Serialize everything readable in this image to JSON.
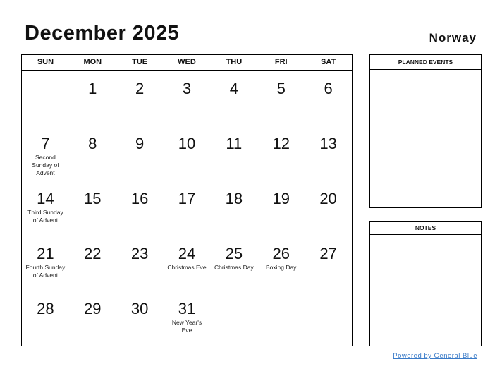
{
  "header": {
    "title": "December 2025",
    "country": "Norway"
  },
  "calendar": {
    "weekdays": [
      "SUN",
      "MON",
      "TUE",
      "WED",
      "THU",
      "FRI",
      "SAT"
    ],
    "cells": [
      {
        "day": "",
        "event": ""
      },
      {
        "day": "1",
        "event": ""
      },
      {
        "day": "2",
        "event": ""
      },
      {
        "day": "3",
        "event": ""
      },
      {
        "day": "4",
        "event": ""
      },
      {
        "day": "5",
        "event": ""
      },
      {
        "day": "6",
        "event": ""
      },
      {
        "day": "7",
        "event": "Second Sunday of Advent"
      },
      {
        "day": "8",
        "event": ""
      },
      {
        "day": "9",
        "event": ""
      },
      {
        "day": "10",
        "event": ""
      },
      {
        "day": "11",
        "event": ""
      },
      {
        "day": "12",
        "event": ""
      },
      {
        "day": "13",
        "event": ""
      },
      {
        "day": "14",
        "event": "Third Sunday of Advent"
      },
      {
        "day": "15",
        "event": ""
      },
      {
        "day": "16",
        "event": ""
      },
      {
        "day": "17",
        "event": ""
      },
      {
        "day": "18",
        "event": ""
      },
      {
        "day": "19",
        "event": ""
      },
      {
        "day": "20",
        "event": ""
      },
      {
        "day": "21",
        "event": "Fourth Sunday of Advent"
      },
      {
        "day": "22",
        "event": ""
      },
      {
        "day": "23",
        "event": ""
      },
      {
        "day": "24",
        "event": "Christmas Eve"
      },
      {
        "day": "25",
        "event": "Christmas Day"
      },
      {
        "day": "26",
        "event": "Boxing Day"
      },
      {
        "day": "27",
        "event": ""
      },
      {
        "day": "28",
        "event": ""
      },
      {
        "day": "29",
        "event": ""
      },
      {
        "day": "30",
        "event": ""
      },
      {
        "day": "31",
        "event": "New Year's Eve"
      },
      {
        "day": "",
        "event": ""
      },
      {
        "day": "",
        "event": ""
      },
      {
        "day": "",
        "event": ""
      }
    ]
  },
  "panels": {
    "planned_events": "PLANNED EVENTS",
    "notes": "NOTES"
  },
  "footer": {
    "link": "Powered by General Blue",
    "link_color": "#3a7bc8"
  }
}
